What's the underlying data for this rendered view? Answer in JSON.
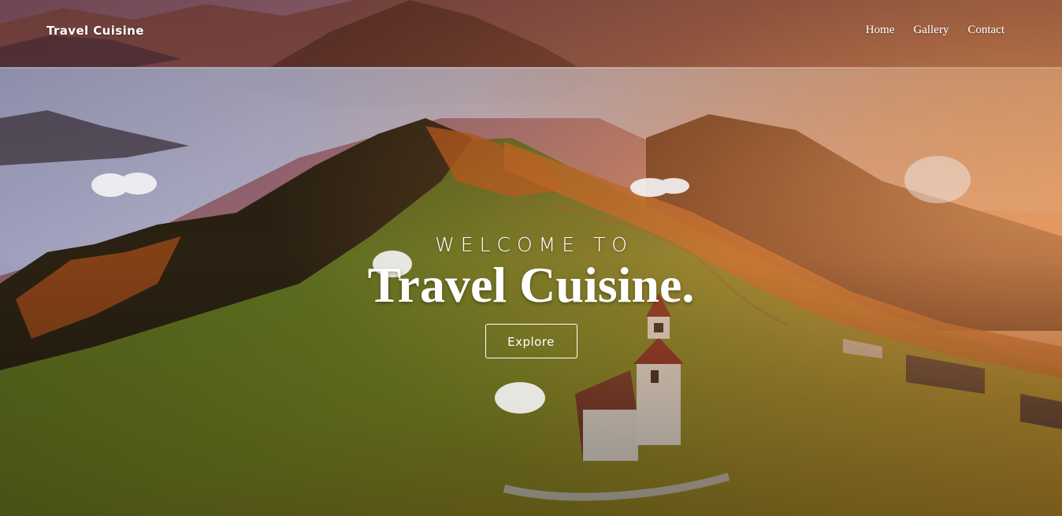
{
  "nav": {
    "brand": "Travel Cuisine",
    "links": [
      "Home",
      "Gallery",
      "Contact"
    ]
  },
  "hero": {
    "welcome": "WELCOME TO",
    "title": "Travel Cuisine.",
    "button_label": "Explore"
  },
  "colors": {
    "sky_warm": "#e98a5a",
    "mist": "#c9cbe0",
    "meadow": "#6f8a2c",
    "forest": "#3a2a18",
    "autumn": "#c8621e",
    "text": "#ffffff"
  }
}
